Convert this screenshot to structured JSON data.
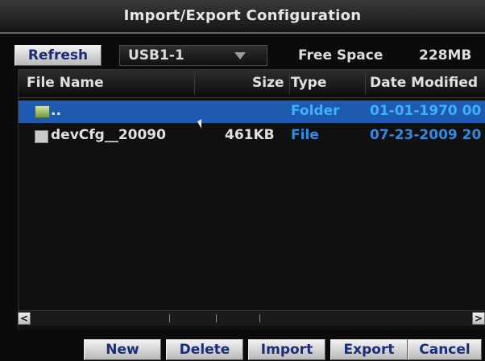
{
  "title": "Import/Export Configuration",
  "toolbar": {
    "refresh_label": "Refresh",
    "device_selected": "USB1-1",
    "free_space_label": "Free Space",
    "free_space_value": "228MB"
  },
  "table": {
    "columns": [
      "File Name",
      "Size",
      "Type",
      "Date Modified"
    ],
    "rows": [
      {
        "name": "..",
        "size": "",
        "type": "Folder",
        "date": "01-01-1970 00",
        "icon": "folder-icon",
        "selected": true
      },
      {
        "name": "devCfg__20090",
        "size": "461KB",
        "type": "File",
        "date": "07-23-2009 20",
        "icon": "file-icon",
        "selected": false
      }
    ]
  },
  "scrollbar": {
    "left_arrow": "<",
    "right_arrow": ">"
  },
  "buttons": {
    "new": "New",
    "delete": "Delete",
    "import": "Import",
    "export": "Export",
    "cancel": "Cancel"
  },
  "colors": {
    "accent_blue": "#2b8ee6",
    "selection": "#1e5bb0",
    "button_text": "#1a2d7a"
  }
}
